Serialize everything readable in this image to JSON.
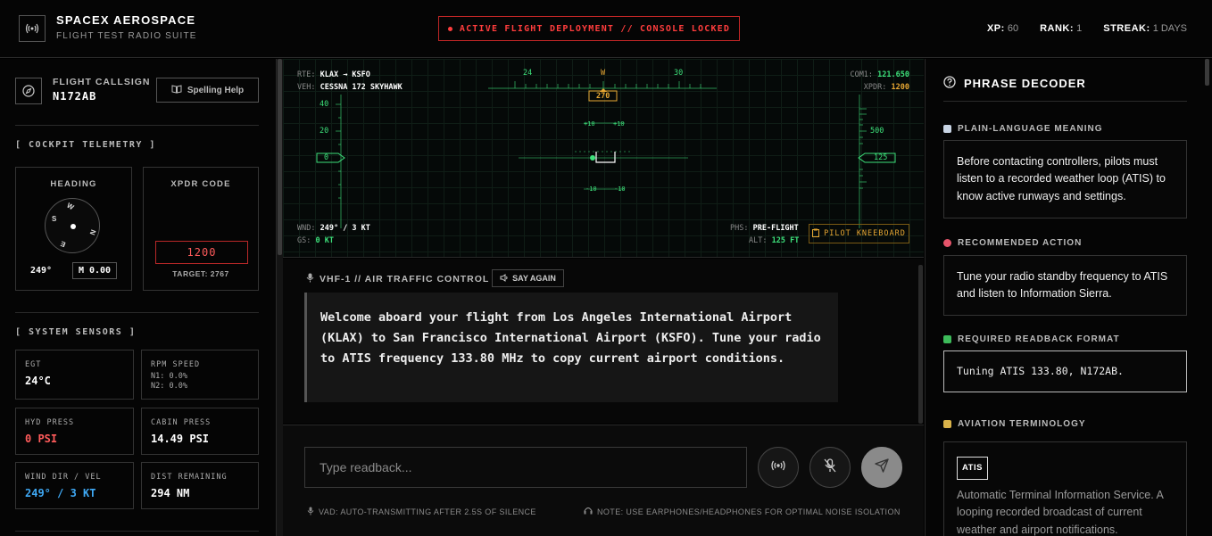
{
  "header": {
    "brand": "SPACEX AEROSPACE",
    "subtitle": "FLIGHT TEST RADIO SUITE",
    "alert": "ACTIVE FLIGHT DEPLOYMENT // CONSOLE LOCKED",
    "xp_label": "XP:",
    "xp_value": "60",
    "rank_label": "RANK:",
    "rank_value": "1",
    "streak_label": "STREAK:",
    "streak_value": "1 DAYS"
  },
  "left": {
    "callsign_label": "FLIGHT CALLSIGN",
    "callsign": "N172AB",
    "spelling_help": "Spelling Help",
    "telemetry_title": "[ COCKPIT TELEMETRY ]",
    "heading_title": "HEADING",
    "heading_value": "249°",
    "heading_mag": "M 0.00",
    "compass_labels": {
      "s": "S",
      "w": "W",
      "n": "N",
      "e": "E"
    },
    "xpdr_title": "XPDR CODE",
    "xpdr_value": "1200",
    "xpdr_target": "TARGET: 2767",
    "sensors_title": "[ SYSTEM SENSORS ]",
    "sensors": [
      {
        "label": "EGT",
        "value": "24°C"
      },
      {
        "label": "RPM SPEED",
        "n1": "N1: 0.0%",
        "n2": "N2: 0.0%"
      },
      {
        "label": "HYD PRESS",
        "value": "0 PSI"
      },
      {
        "label": "CABIN PRESS",
        "value": "14.49 PSI"
      },
      {
        "label": "WIND DIR / VEL",
        "value": "249° / 3 KT"
      },
      {
        "label": "DIST REMAINING",
        "value": "294 NM"
      }
    ]
  },
  "hud": {
    "rte_label": "RTE:",
    "rte_value": "KLAX → KSFO",
    "veh_label": "VEH:",
    "veh_value": "CESSNA 172 SKYHAWK",
    "com1_label": "COM1:",
    "com1_value": "121.650",
    "xpdr_label": "XPDR:",
    "xpdr_value": "1200",
    "hdg_tape_left": "24",
    "hdg_tape_mid": "W",
    "hdg_tape_right": "30",
    "hdg_box": "270",
    "pitch_up": "+10",
    "pitch_down": "-10",
    "speed_ticks": [
      "40",
      "20"
    ],
    "speed_box": "0",
    "alt_tick": "500",
    "alt_box": "125",
    "wnd_label": "WND:",
    "wnd_value": "249° / 3 KT",
    "gs_label": "GS:",
    "gs_value": "0 KT",
    "phs_label": "PHS:",
    "phs_value": "PRE-FLIGHT",
    "alt_label": "ALT:",
    "alt_value": "125 FT",
    "kneeboard": "PILOT KNEEBOARD"
  },
  "atc": {
    "channel": "VHF-1 // AIR TRAFFIC CONTROL",
    "say_again": "SAY AGAIN",
    "message": "Welcome aboard your flight from Los Angeles International Airport (KLAX) to San Francisco International Airport (KSFO). Tune your radio to ATIS frequency 133.80 MHz to copy current airport conditions."
  },
  "input": {
    "placeholder": "Type readback...",
    "vad_note": "VAD: AUTO-TRANSMITTING AFTER 2.5S OF SILENCE",
    "earphone_note": "NOTE: USE EARPHONES/HEADPHONES FOR OPTIMAL NOISE ISOLATION"
  },
  "decoder": {
    "title": "PHRASE DECODER",
    "meaning_label": "PLAIN-LANGUAGE MEANING",
    "meaning": "Before contacting controllers, pilots must listen to a recorded weather loop (ATIS) to know active runways and settings.",
    "action_label": "RECOMMENDED ACTION",
    "action": "Tune your radio standby frequency to ATIS and listen to Information Sierra.",
    "format_label": "REQUIRED READBACK FORMAT",
    "format": "Tuning ATIS 133.80, N172AB.",
    "term_label": "AVIATION TERMINOLOGY",
    "term": "ATIS",
    "term_desc": "Automatic Terminal Information Service. A looping recorded broadcast of current weather and airport notifications."
  },
  "colors": {
    "alert_red": "#ff3d3d",
    "hud_green": "#3de07a",
    "hud_amber": "#e6a733",
    "wind_blue": "#3fa9f5",
    "hyd_red": "#ff5b5b"
  },
  "icons": [
    "radio-icon",
    "compass-icon",
    "book-icon",
    "microphone-icon",
    "speaker-icon",
    "broadcast-icon",
    "mic-off-icon",
    "send-icon",
    "help-circle-icon",
    "headphones-icon",
    "clipboard-icon"
  ]
}
